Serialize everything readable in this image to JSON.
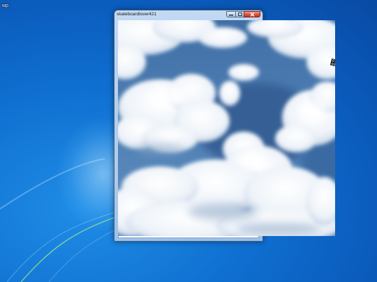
{
  "desktop": {
    "icon_label": "wp",
    "background_accent": "#0f6fd0"
  },
  "window": {
    "title": "skateboardlover421",
    "buttons": {
      "minimize": "minimize-icon",
      "maximize": "maximize-icon",
      "close": "close-icon"
    }
  },
  "content": {
    "image": "clouds-in-blue-sky",
    "mark_glyph": "଍"
  }
}
